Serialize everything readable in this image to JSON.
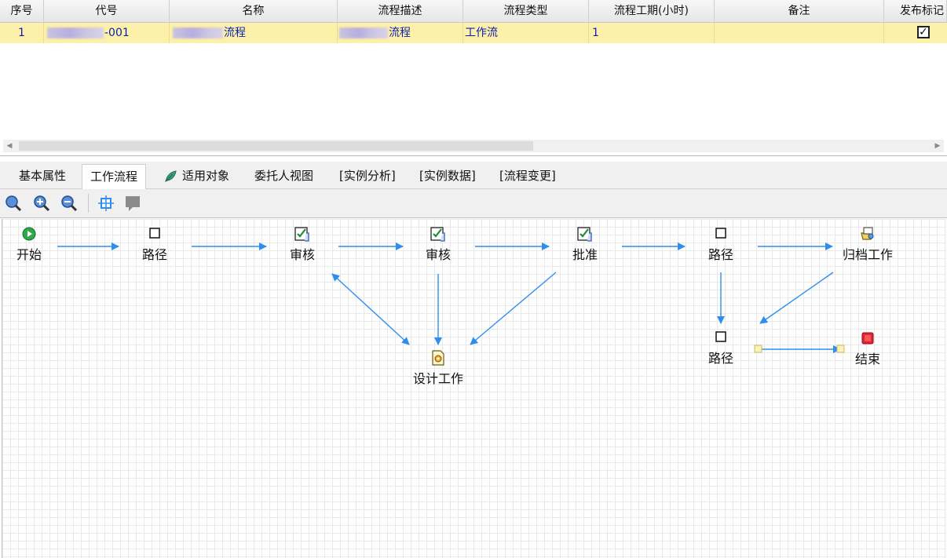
{
  "table": {
    "columns": [
      "序号",
      "代号",
      "名称",
      "流程描述",
      "流程类型",
      "流程工期(小时)",
      "备注",
      "发布标记"
    ],
    "row": {
      "index": "1",
      "code_suffix": "-001",
      "name_suffix": "流程",
      "desc_suffix": "流程",
      "type": "工作流",
      "duration": "1",
      "note": "",
      "published": true
    }
  },
  "tabs": [
    "基本属性",
    "工作流程",
    "适用对象",
    "委托人视图",
    "[实例分析]",
    "[实例数据]",
    "[流程变更]"
  ],
  "active_tab": "工作流程",
  "toolbar": [
    "zoom-fit-icon",
    "zoom-in-icon",
    "zoom-out-icon",
    "center-icon",
    "comment-icon"
  ],
  "nodes": {
    "start": "开始",
    "route1": "路径",
    "review1": "审核",
    "review2": "审核",
    "approve": "批准",
    "route2": "路径",
    "archive": "归档工作",
    "design": "设计工作",
    "route3": "路径",
    "end": "结束"
  },
  "colors": {
    "arrow": "#2e8ef0",
    "selected_row": "#fdf0a8",
    "row_text": "#0a1fb0"
  }
}
